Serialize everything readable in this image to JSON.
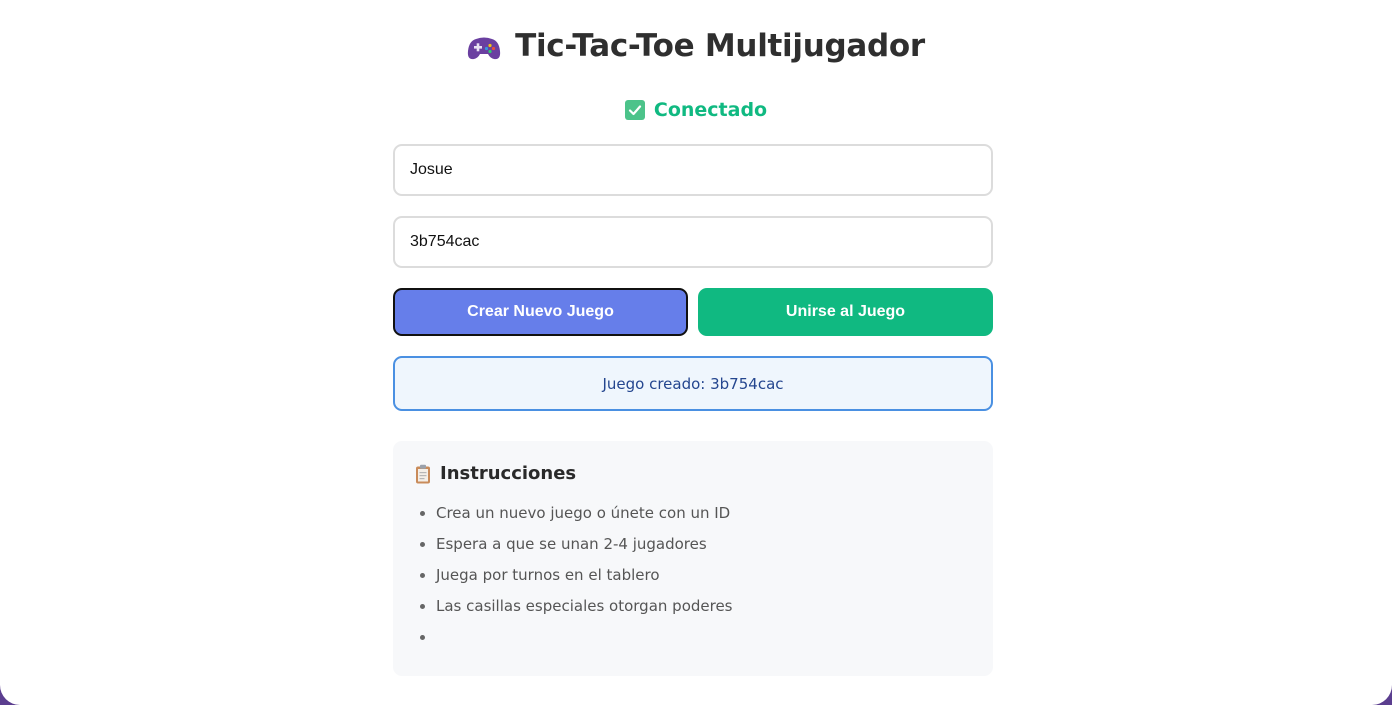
{
  "app": {
    "title": "Tic-Tac-Toe Multijugador",
    "title_icon": "gamepad-icon"
  },
  "status": {
    "icon": "check-icon",
    "text": "Conectado",
    "color": "#10b981"
  },
  "form": {
    "player_name_value": "Josue",
    "game_id_value": "3b754cac"
  },
  "buttons": {
    "create_label": "Crear Nuevo Juego",
    "join_label": "Unirse al Juego",
    "create_color": "#667eea",
    "join_color": "#10b981"
  },
  "message": {
    "text": "Juego creado: 3b754cac"
  },
  "instructions": {
    "icon": "clipboard-icon",
    "title": "Instrucciones",
    "items": [
      "Crea un nuevo juego o únete con un ID",
      "Espera a que se unan 2-4 jugadores",
      "Juega por turnos en el tablero",
      "Las casillas especiales otorgan poderes",
      ""
    ]
  }
}
